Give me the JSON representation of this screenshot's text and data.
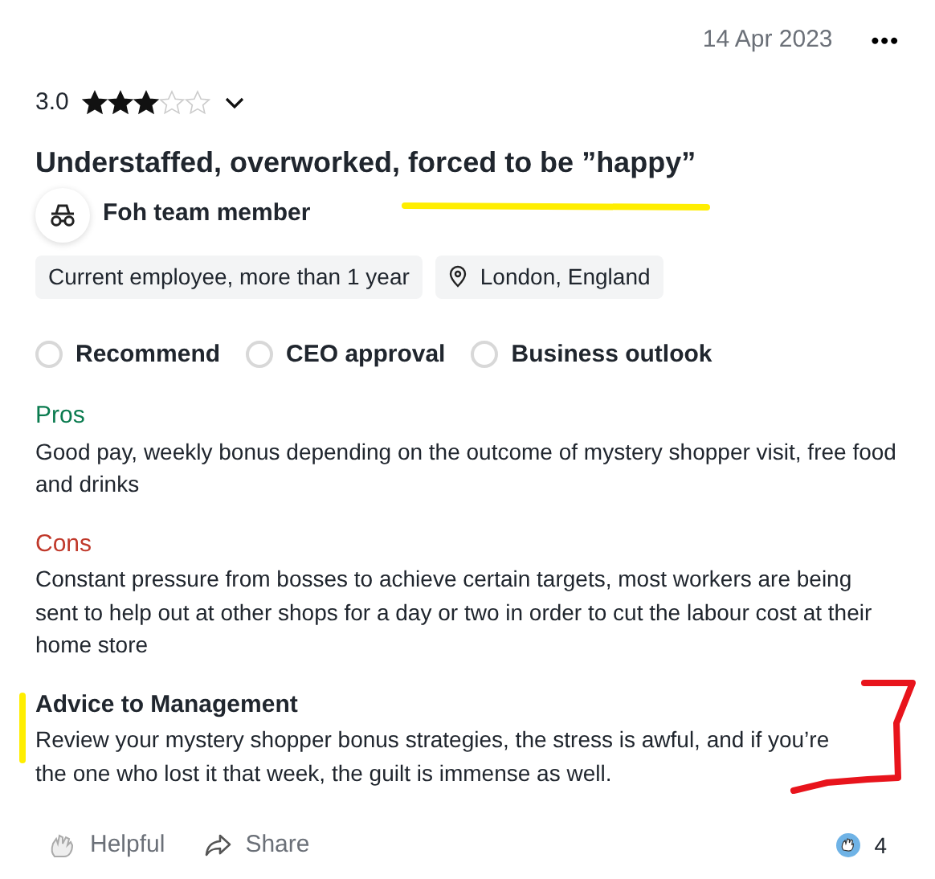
{
  "date": "14 Apr 2023",
  "more_icon": "•••",
  "rating": {
    "score": "3.0",
    "stars": 3
  },
  "title": "Understaffed, overworked, forced to be ”happy”",
  "role": "Foh team member",
  "tags": [
    {
      "label": "Current employee, more than 1 year",
      "kind": "plain"
    },
    {
      "label": "London, England",
      "kind": "location"
    }
  ],
  "indicators": [
    {
      "label": "Recommend",
      "selected": false
    },
    {
      "label": "CEO approval",
      "selected": false
    },
    {
      "label": "Business outlook",
      "selected": false
    }
  ],
  "sections": [
    {
      "heading": "Pros",
      "color": "#0a7b4f",
      "text": "Good pay, weekly bonus depending on the outcome of mystery shopper visit, free food and drinks"
    },
    {
      "heading": "Cons",
      "color": "#c0392b",
      "text": "Constant pressure from bosses to achieve certain targets, most workers are being sent to help out at other shops for a day or two in order to cut the labour cost at their home store"
    },
    {
      "heading": "Advice to Management",
      "color": "#20262e",
      "text": "Review your mystery shopper bonus strategies, the stress is awful, and if you’re the one who lost it that week, the guilt is immense as well."
    }
  ],
  "actions": [
    {
      "label": "Helpful",
      "kind": "helpful"
    },
    {
      "label": "Share",
      "kind": "share"
    }
  ],
  "reaction_count": "4"
}
